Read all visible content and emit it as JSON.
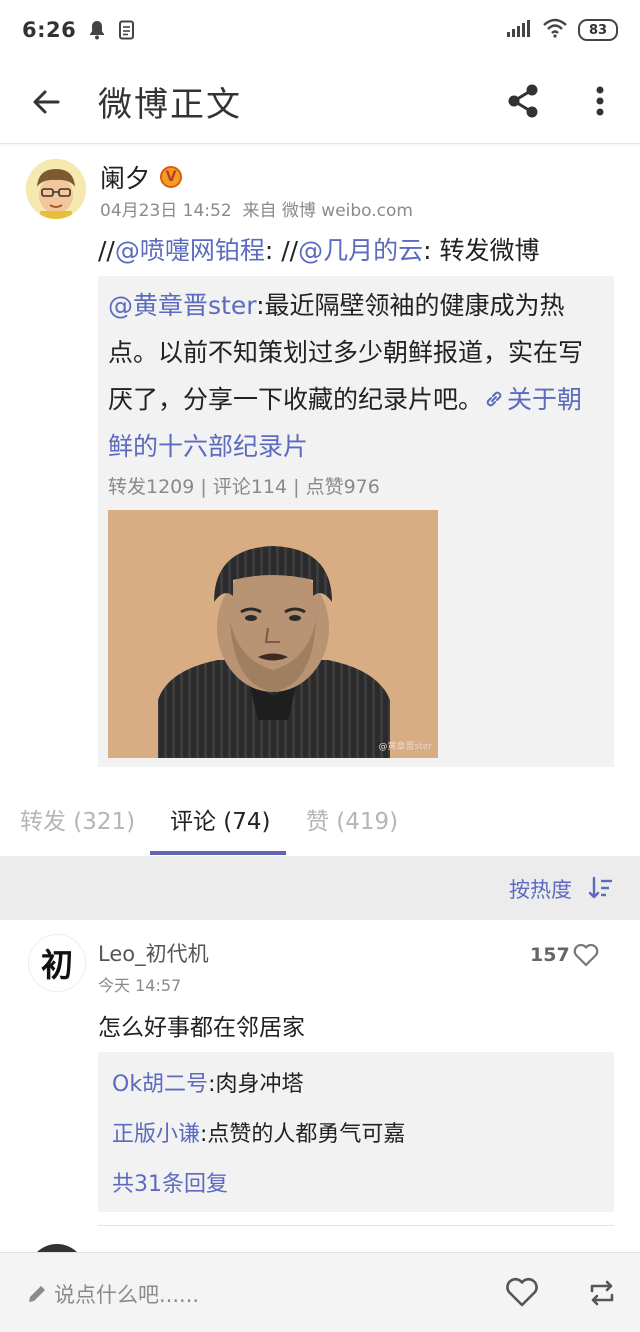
{
  "status_bar": {
    "time": "6:26",
    "battery": "83"
  },
  "app_bar": {
    "title": "微博正文"
  },
  "post": {
    "author": "阑夕",
    "verified_badge": "V",
    "time": "04月23日 14:52",
    "source": "来自 微博 weibo.com",
    "text_segments": {
      "sep1": "//",
      "mention1": "@喷嚏网铂程",
      "sep2": ": //",
      "mention2": "@几月的云",
      "body": ": 转发微博"
    },
    "repost": {
      "author": "@黄章晋ster",
      "text": ":最近隔壁领袖的健康成为热点。以前不知策划过多少朝鲜报道，实在写厌了，分享一下收藏的纪录片吧。",
      "link_text": "关于朝鲜的十六部纪录片",
      "stats": "转发1209 | 评论114 | 点赞976",
      "image_watermark": "@黄章晋ster"
    }
  },
  "tabs": [
    {
      "label": "转发 (321)",
      "active": false
    },
    {
      "label": "评论 (74)",
      "active": true
    },
    {
      "label": "赞 (419)",
      "active": false
    }
  ],
  "sort": {
    "label": "按热度"
  },
  "comments": [
    {
      "avatar_char": "初",
      "name": "Leo_初代机",
      "time": "今天 14:57",
      "likes": "157",
      "text": "怎么好事都在邻居家",
      "replies": [
        {
          "name": "Ok胡二号",
          "text": ":肉身冲塔"
        },
        {
          "name": "正版小谦",
          "text": ":点赞的人都勇气可嘉"
        }
      ],
      "more_replies": "共31条回复"
    }
  ],
  "bottom_bar": {
    "placeholder": "说点什么吧......"
  },
  "colors": {
    "accent": "#5c6bc0",
    "tab_underline": "#6264b5",
    "image_bg": "#d9ad83"
  }
}
